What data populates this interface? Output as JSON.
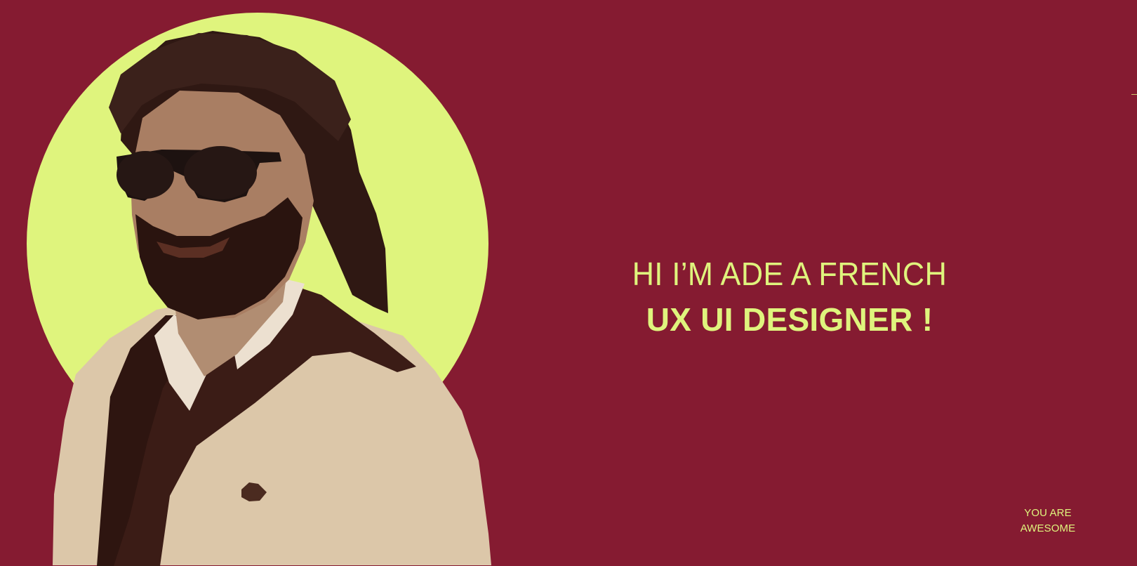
{
  "hero": {
    "headline_line_1": "HI I’M ADE A FRENCH",
    "headline_line_2": "UX UI DESIGNER !",
    "footer_note": "YOU ARE AWESOME"
  },
  "colors": {
    "background": "#851b31",
    "accent": "#dff47d",
    "photo_tone": "#dcc7a9"
  },
  "icons": {
    "portrait": "person-photo",
    "circle": "accent-circle"
  }
}
